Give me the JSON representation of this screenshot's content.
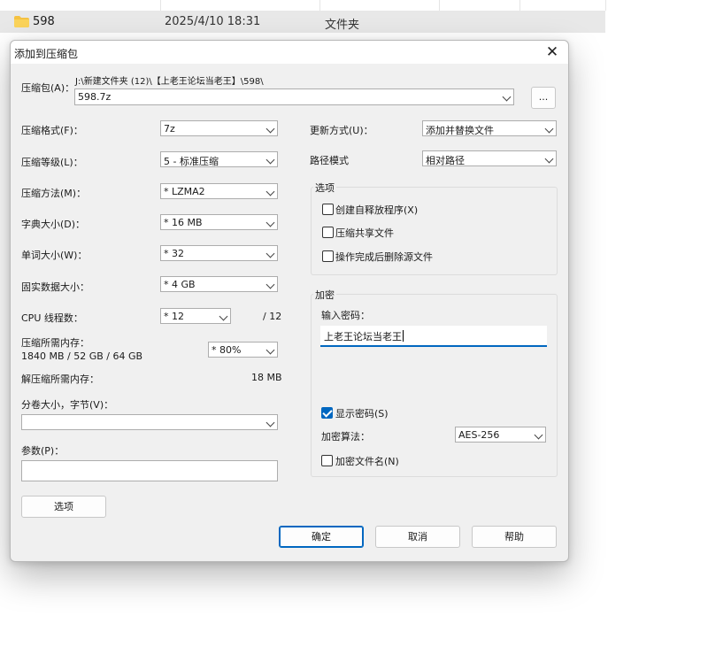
{
  "file_row": {
    "name": "598",
    "date": "2025/4/10 18:31",
    "type": "文件夹",
    "icon": "folder-icon"
  },
  "dialog": {
    "title": "添加到压缩包",
    "close_glyph": "✕",
    "archive": {
      "label": "压缩包(A)：",
      "path": "J:\\新建文件夹 (12)\\【上老王论坛当老王】\\598\\",
      "value": "598.7z",
      "browse_label": "..."
    },
    "left": {
      "format_label": "压缩格式(F)：",
      "format_value": "7z",
      "level_label": "压缩等级(L)：",
      "level_value": "5 - 标准压缩",
      "method_label": "压缩方法(M)：",
      "method_value": "*  LZMA2",
      "dict_label": "字典大小(D)：",
      "dict_value": "*  16 MB",
      "word_label": "单词大小(W)：",
      "word_value": "*  32",
      "solid_label": "固实数据大小：",
      "solid_value": "*  4 GB",
      "threads_label": "CPU 线程数：",
      "threads_value": "*  12",
      "threads_total": "/ 12",
      "mem_label": "压缩所需内存：",
      "mem_detail": "1840 MB / 52 GB / 64 GB",
      "mem_value": "*  80%",
      "decomp_label": "解压缩所需内存：",
      "decomp_value": "18 MB",
      "split_label": "分卷大小，字节(V)：",
      "split_value": "",
      "params_label": "参数(P)：",
      "params_value": ""
    },
    "right": {
      "update_label": "更新方式(U)：",
      "update_value": "添加并替换文件",
      "path_label": "路径模式",
      "path_value": "相对路径",
      "options_group": "选项",
      "opt_sfx": "创建自释放程序(X)",
      "opt_shared": "压缩共享文件",
      "opt_delete": "操作完成后删除源文件",
      "encrypt_group": "加密",
      "password_label": "输入密码：",
      "password_value": "上老王论坛当老王",
      "show_password": "显示密码(S)",
      "method_label": "加密算法：",
      "method_value": "AES-256",
      "encrypt_names": "加密文件名(N)"
    },
    "buttons": {
      "options": "选项",
      "ok": "确定",
      "cancel": "取消",
      "help": "帮助"
    },
    "accent": "#0067c0"
  }
}
